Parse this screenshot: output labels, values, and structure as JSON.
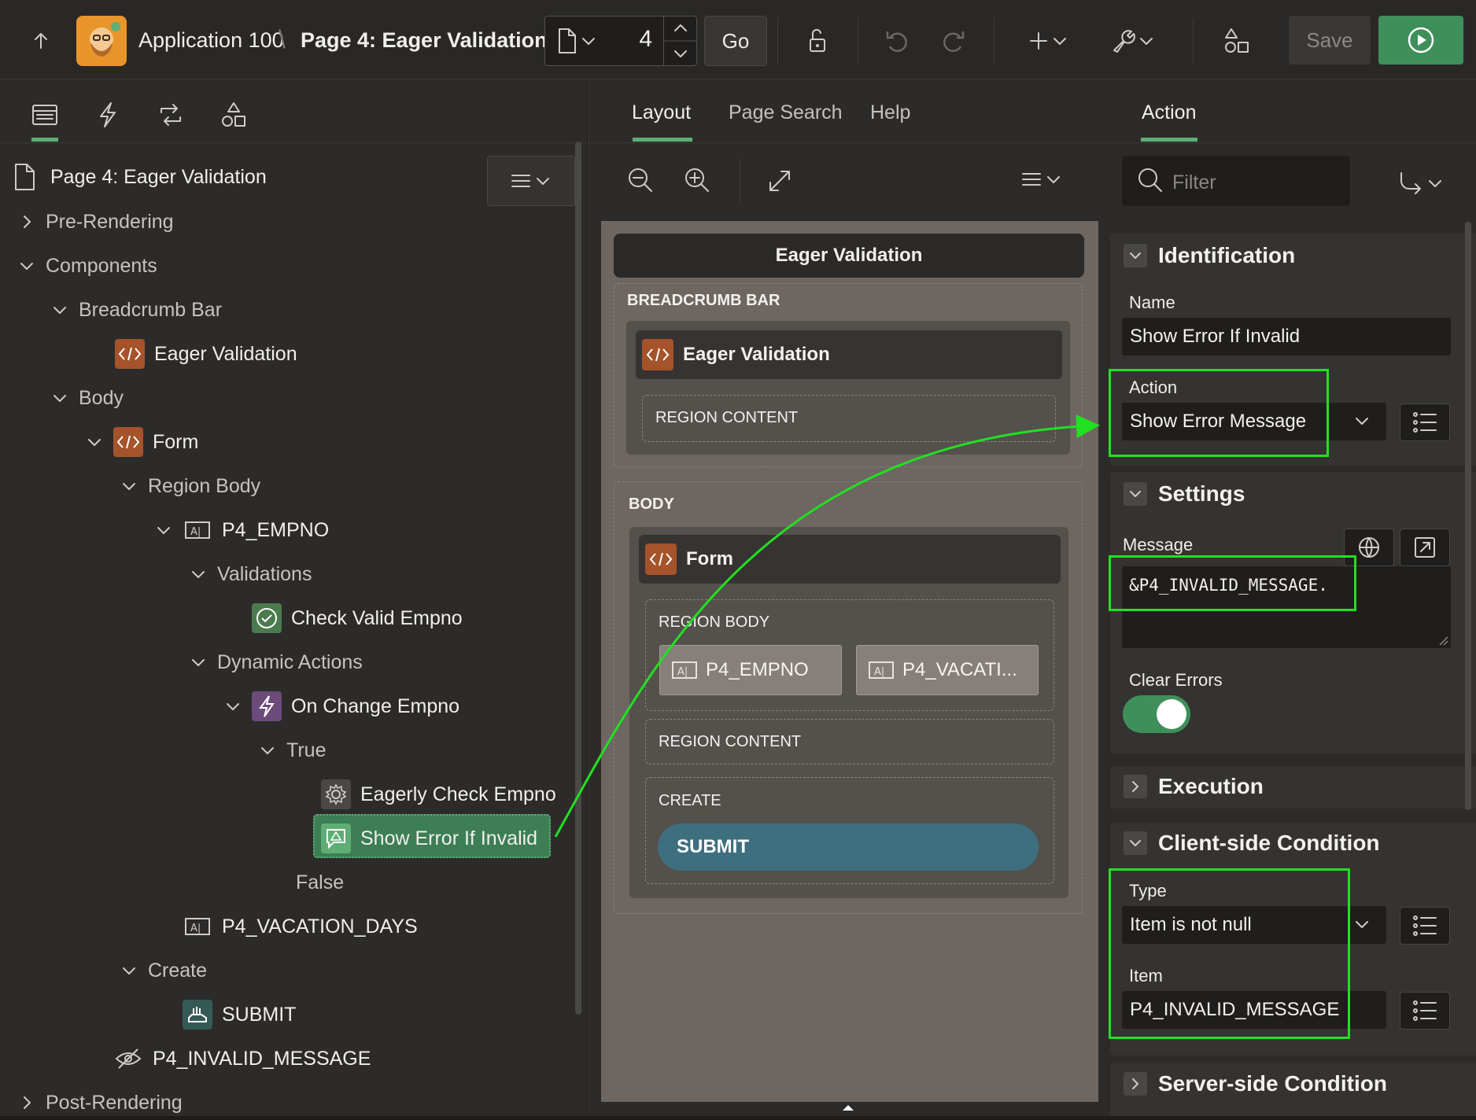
{
  "header": {
    "app_title": "Application 100",
    "breadcrumb_sep": "\\",
    "page_title": "Page 4: Eager Validation",
    "page_number": "4",
    "go_label": "Go",
    "save_label": "Save"
  },
  "left_panel": {
    "tabs": [
      "rendering",
      "dynamic-actions",
      "processing",
      "shared-components"
    ],
    "tree_root": "Page 4: Eager Validation",
    "tree": {
      "pre_rendering": "Pre-Rendering",
      "components": "Components",
      "breadcrumb_bar": "Breadcrumb Bar",
      "eager_validation": "Eager Validation",
      "body": "Body",
      "form": "Form",
      "region_body": "Region Body",
      "p4_empno": "P4_EMPNO",
      "validations": "Validations",
      "check_valid_empno": "Check Valid Empno",
      "dynamic_actions": "Dynamic Actions",
      "on_change_empno": "On Change Empno",
      "true_label": "True",
      "eagerly_check_empno": "Eagerly Check Empno",
      "show_error_if_invalid": "Show Error If Invalid",
      "false_label": "False",
      "p4_vacation_days": "P4_VACATION_DAYS",
      "create": "Create",
      "submit": "SUBMIT",
      "p4_invalid_message": "P4_INVALID_MESSAGE",
      "post_rendering": "Post-Rendering"
    }
  },
  "center_panel": {
    "tabs": {
      "layout": "Layout",
      "page_search": "Page Search",
      "help": "Help"
    },
    "canvas": {
      "page_header": "Eager Validation",
      "breadcrumb_bar": "BREADCRUMB BAR",
      "breadcrumb_region": "Eager Validation",
      "region_content_1": "REGION CONTENT",
      "body": "BODY",
      "form_region": "Form",
      "region_body": "REGION BODY",
      "item_1": "P4_EMPNO",
      "item_2": "P4_VACATI...",
      "region_content_2": "REGION CONTENT",
      "create": "CREATE",
      "submit": "SUBMIT"
    }
  },
  "right_panel": {
    "tab": "Action",
    "filter_placeholder": "Filter",
    "identification": {
      "title": "Identification",
      "name_label": "Name",
      "name_value": "Show Error If Invalid",
      "action_label": "Action",
      "action_value": "Show Error Message"
    },
    "settings": {
      "title": "Settings",
      "message_label": "Message",
      "message_value": "&P4_INVALID_MESSAGE.",
      "clear_errors_label": "Clear Errors",
      "clear_errors_on": true
    },
    "execution": {
      "title": "Execution"
    },
    "client_condition": {
      "title": "Client-side Condition",
      "type_label": "Type",
      "type_value": "Item is not null",
      "item_label": "Item",
      "item_value": "P4_INVALID_MESSAGE"
    },
    "server_condition": {
      "title": "Server-side Condition"
    }
  },
  "colors": {
    "accent_green": "#5fae75",
    "run_button": "#3f8f5a",
    "highlight": "#22e022",
    "region_icon": "#a5532a",
    "submit_button": "#3e6f7f"
  }
}
